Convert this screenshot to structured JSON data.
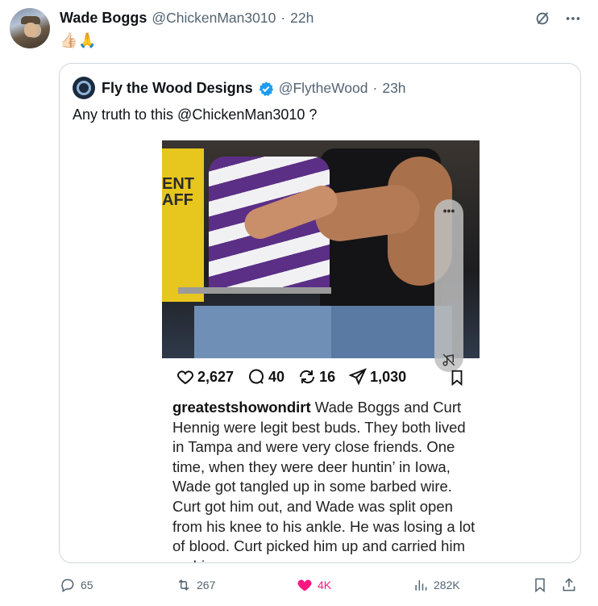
{
  "post": {
    "author_name": "Wade Boggs",
    "author_handle": "@ChickenMan3010",
    "time": "22h",
    "separator": "·",
    "body_emoji": "👍🏻🙏"
  },
  "quoted": {
    "author_name": "Fly the Wood Designs",
    "author_handle": "@FlytheWood",
    "separator": "·",
    "time": "23h",
    "text": "Any truth to this @ChickenMan3010 ?",
    "image_overlay_dots": "•••",
    "photo_sign_text": "ENT\nAFF"
  },
  "instagram": {
    "likes": "2,627",
    "comments": "40",
    "reposts": "16",
    "shares": "1,030",
    "username": "greatestshowondirt",
    "caption": " Wade Boggs and Curt Hennig were legit best buds. They both lived in Tampa and were very close friends. One time, when they were deer huntin’ in Iowa, Wade got tangled up in some barbed wire. Curt got him out, and Wade was split open from his knee to his ankle. He was losing a lot of blood. Curt picked him up and carried him on his"
  },
  "actions": {
    "replies": "65",
    "reposts": "267",
    "likes": "4K",
    "views": "282K"
  },
  "colors": {
    "like_active": "#f91880",
    "verified": "#1d9bf0",
    "muted_text": "#536471"
  },
  "icons": [
    "grok-icon",
    "more-icon",
    "verified-badge-icon",
    "heart-icon",
    "comment-icon",
    "repost-icon",
    "share-icon",
    "bookmark-icon",
    "reply-icon",
    "like-icon",
    "views-icon",
    "upload-icon",
    "no-sound-icon"
  ]
}
